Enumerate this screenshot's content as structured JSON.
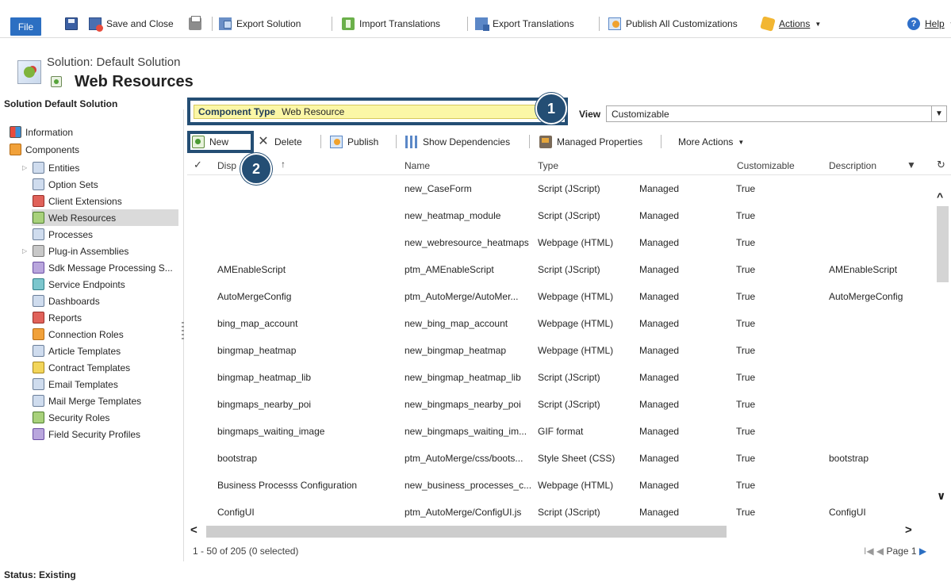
{
  "ribbon": {
    "file": "File",
    "save_close": "Save and Close",
    "export_solution": "Export Solution",
    "import_translations": "Import Translations",
    "export_translations": "Export Translations",
    "publish_all": "Publish All Customizations",
    "actions": "Actions",
    "help": "Help"
  },
  "header": {
    "subtitle": "Solution: Default Solution",
    "title": "Web Resources"
  },
  "nav": {
    "solution_label": "Solution Default Solution",
    "items": [
      {
        "label": "Information",
        "icon": "information-icon"
      },
      {
        "label": "Components",
        "icon": "components-icon"
      },
      {
        "label": "Entities",
        "icon": "entities-icon"
      },
      {
        "label": "Option Sets",
        "icon": "option-sets-icon"
      },
      {
        "label": "Client Extensions",
        "icon": "client-extensions-icon"
      },
      {
        "label": "Web Resources",
        "icon": "web-resources-icon"
      },
      {
        "label": "Processes",
        "icon": "processes-icon"
      },
      {
        "label": "Plug-in Assemblies",
        "icon": "plugin-assemblies-icon"
      },
      {
        "label": "Sdk Message Processing S...",
        "icon": "sdk-message-icon"
      },
      {
        "label": "Service Endpoints",
        "icon": "service-endpoints-icon"
      },
      {
        "label": "Dashboards",
        "icon": "dashboards-icon"
      },
      {
        "label": "Reports",
        "icon": "reports-icon"
      },
      {
        "label": "Connection Roles",
        "icon": "connection-roles-icon"
      },
      {
        "label": "Article Templates",
        "icon": "article-templates-icon"
      },
      {
        "label": "Contract Templates",
        "icon": "contract-templates-icon"
      },
      {
        "label": "Email Templates",
        "icon": "email-templates-icon"
      },
      {
        "label": "Mail Merge Templates",
        "icon": "mail-merge-templates-icon"
      },
      {
        "label": "Security Roles",
        "icon": "security-roles-icon"
      },
      {
        "label": "Field Security Profiles",
        "icon": "field-security-profiles-icon"
      }
    ]
  },
  "filter": {
    "component_type_label": "Component Type",
    "component_type_value": "Web Resource",
    "view_label": "View",
    "view_value": "Customizable"
  },
  "markers": [
    "1",
    "2"
  ],
  "toolbar": {
    "new": "New",
    "delete": "Delete",
    "publish": "Publish",
    "show_dependencies": "Show Dependencies",
    "managed_properties": "Managed Properties",
    "more_actions": "More Actions"
  },
  "grid": {
    "columns": [
      "Disp",
      "Name",
      "Type",
      "Customizable",
      "Description"
    ],
    "rows": [
      {
        "display": "",
        "name": "new_CaseForm",
        "type": "Script (JScript)",
        "state": "Managed",
        "customizable": "True",
        "description": ""
      },
      {
        "display": "",
        "name": "new_heatmap_module",
        "type": "Script (JScript)",
        "state": "Managed",
        "customizable": "True",
        "description": ""
      },
      {
        "display": "",
        "name": "new_webresource_heatmaps",
        "type": "Webpage (HTML)",
        "state": "Managed",
        "customizable": "True",
        "description": ""
      },
      {
        "display": "AMEnableScript",
        "name": "ptm_AMEnableScript",
        "type": "Script (JScript)",
        "state": "Managed",
        "customizable": "True",
        "description": "AMEnableScript"
      },
      {
        "display": "AutoMergeConfig",
        "name": "ptm_AutoMerge/AutoMer...",
        "type": "Webpage (HTML)",
        "state": "Managed",
        "customizable": "True",
        "description": "AutoMergeConfig"
      },
      {
        "display": "bing_map_account",
        "name": "new_bing_map_account",
        "type": "Webpage (HTML)",
        "state": "Managed",
        "customizable": "True",
        "description": ""
      },
      {
        "display": "bingmap_heatmap",
        "name": "new_bingmap_heatmap",
        "type": "Webpage (HTML)",
        "state": "Managed",
        "customizable": "True",
        "description": ""
      },
      {
        "display": "bingmap_heatmap_lib",
        "name": "new_bingmap_heatmap_lib",
        "type": "Script (JScript)",
        "state": "Managed",
        "customizable": "True",
        "description": ""
      },
      {
        "display": "bingmaps_nearby_poi",
        "name": "new_bingmaps_nearby_poi",
        "type": "Script (JScript)",
        "state": "Managed",
        "customizable": "True",
        "description": ""
      },
      {
        "display": "bingmaps_waiting_image",
        "name": "new_bingmaps_waiting_im...",
        "type": "GIF format",
        "state": "Managed",
        "customizable": "True",
        "description": ""
      },
      {
        "display": "bootstrap",
        "name": "ptm_AutoMerge/css/boots...",
        "type": "Style Sheet (CSS)",
        "state": "Managed",
        "customizable": "True",
        "description": "bootstrap"
      },
      {
        "display": "Business Processs Configuration",
        "name": "new_business_processes_c...",
        "type": "Webpage (HTML)",
        "state": "Managed",
        "customizable": "True",
        "description": ""
      },
      {
        "display": "ConfigUI",
        "name": "ptm_AutoMerge/ConfigUI.js",
        "type": "Script (JScript)",
        "state": "Managed",
        "customizable": "True",
        "description": "ConfigUI"
      }
    ]
  },
  "footer": {
    "record_info": "1 - 50 of 205 (0 selected)",
    "page": "Page 1"
  },
  "status": "Status: Existing"
}
